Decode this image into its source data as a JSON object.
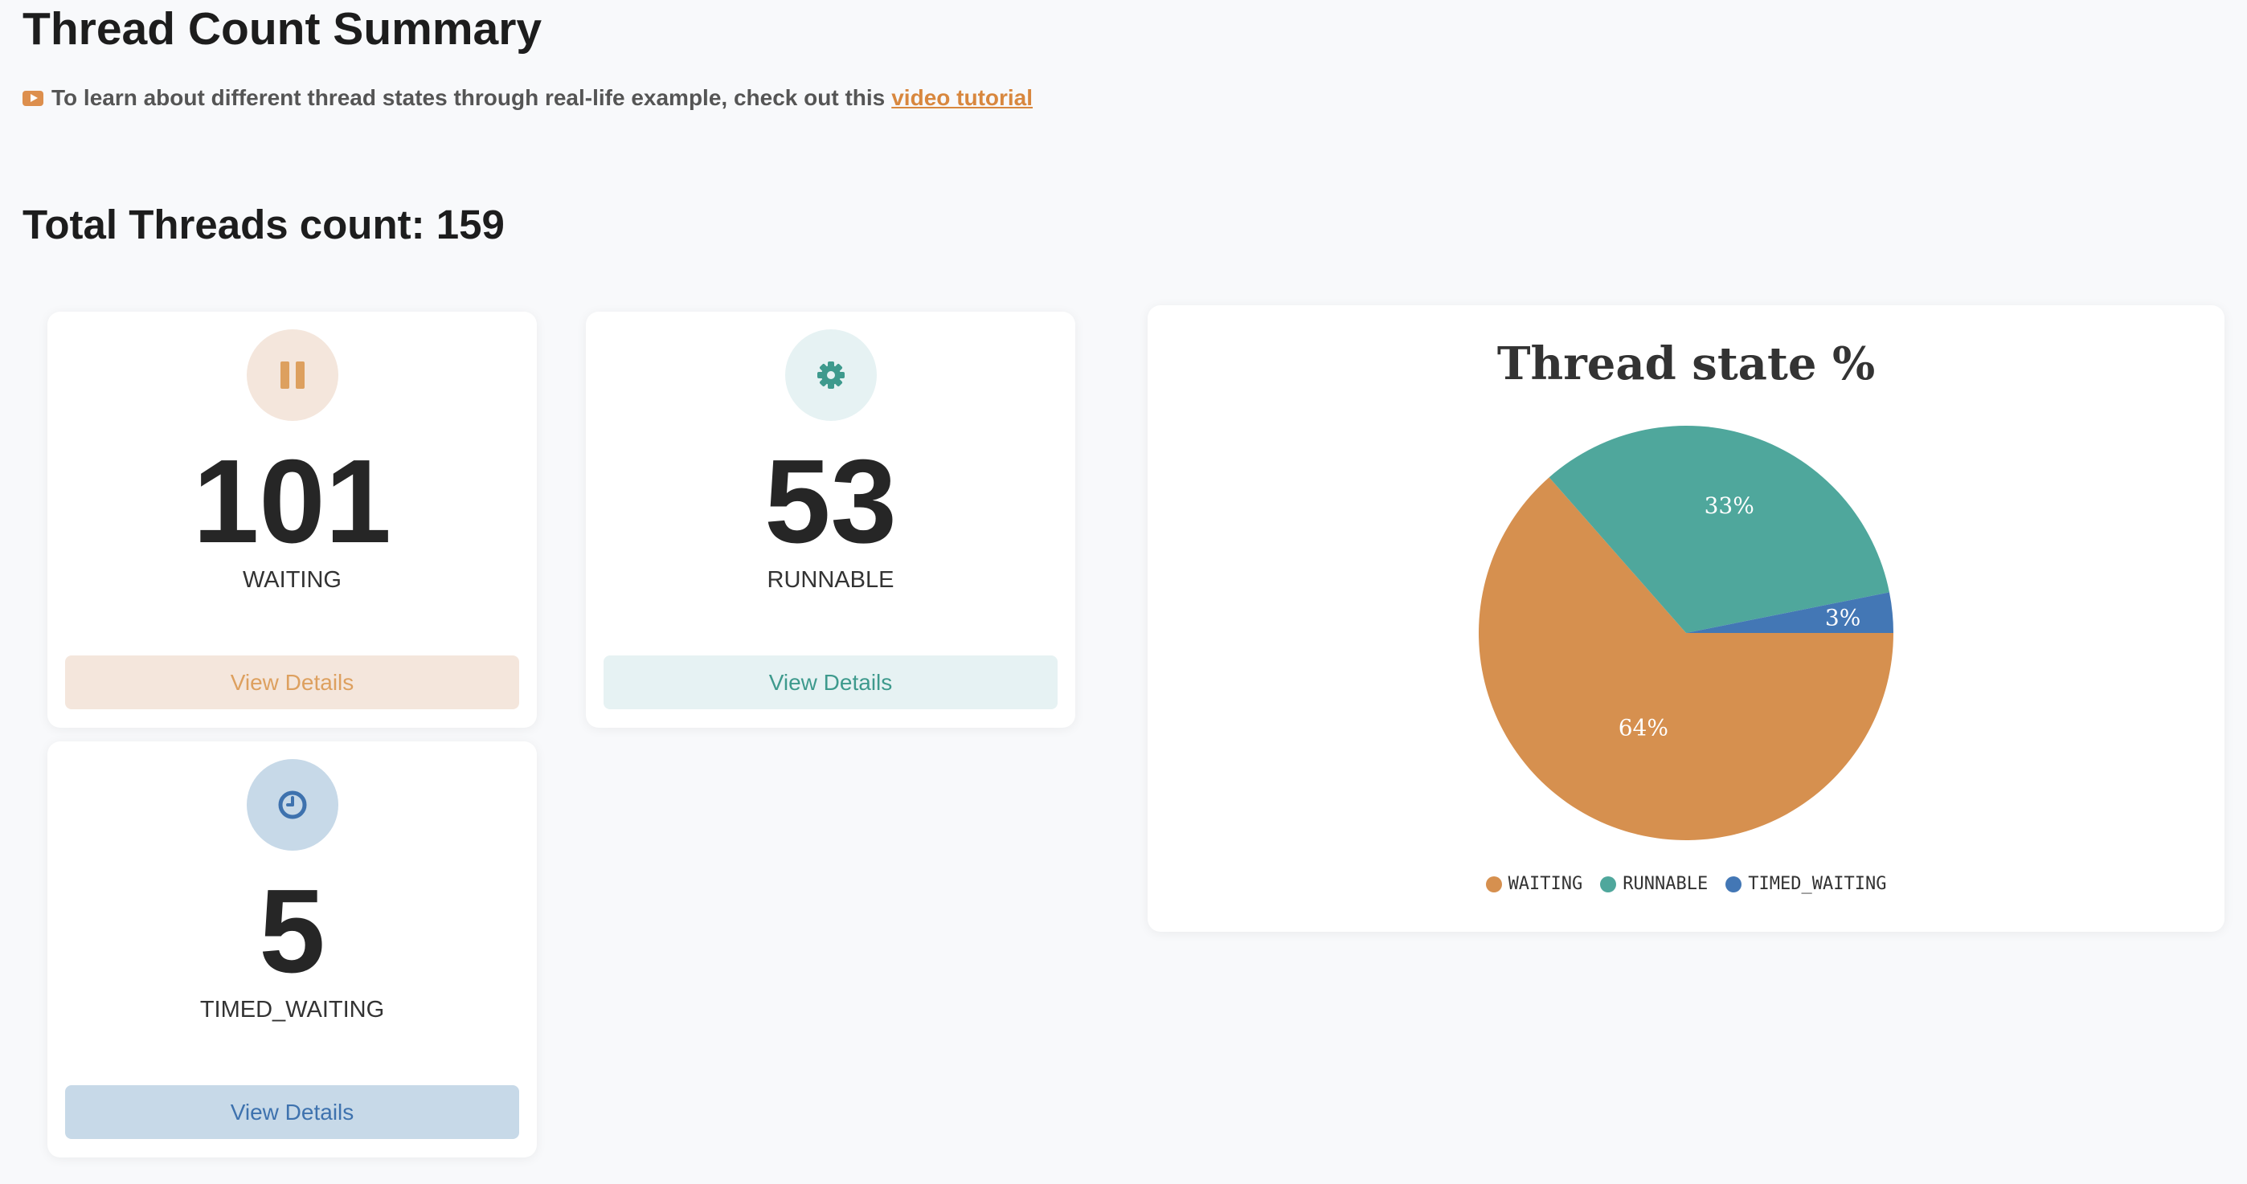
{
  "page": {
    "title": "Thread Count Summary",
    "tutorial_text": "To learn about different thread states through real-life example, check out this",
    "tutorial_link": "video tutorial",
    "total_label": "Total Threads count: 159"
  },
  "icons": {
    "tutorial": "youtube-play-icon",
    "waiting": "pause-icon",
    "runnable": "gear-icon",
    "timed_waiting": "clock-icon"
  },
  "cards": {
    "waiting": {
      "count": "101",
      "label": "WAITING",
      "button": "View Details"
    },
    "runnable": {
      "count": "53",
      "label": "RUNNABLE",
      "button": "View Details"
    },
    "timed_waiting": {
      "count": "5",
      "label": "TIMED_WAITING",
      "button": "View Details"
    }
  },
  "colors": {
    "waiting": "#d6904f",
    "runnable": "#4fa79c",
    "timed_waiting": "#4377b5",
    "link": "#d8873e"
  },
  "chart_data": {
    "type": "pie",
    "title": "Thread state %",
    "categories": [
      "WAITING",
      "RUNNABLE",
      "TIMED_WAITING"
    ],
    "values": [
      101,
      53,
      5
    ],
    "labels": [
      "64%",
      "33%",
      "3%"
    ],
    "legend_position": "bottom"
  }
}
